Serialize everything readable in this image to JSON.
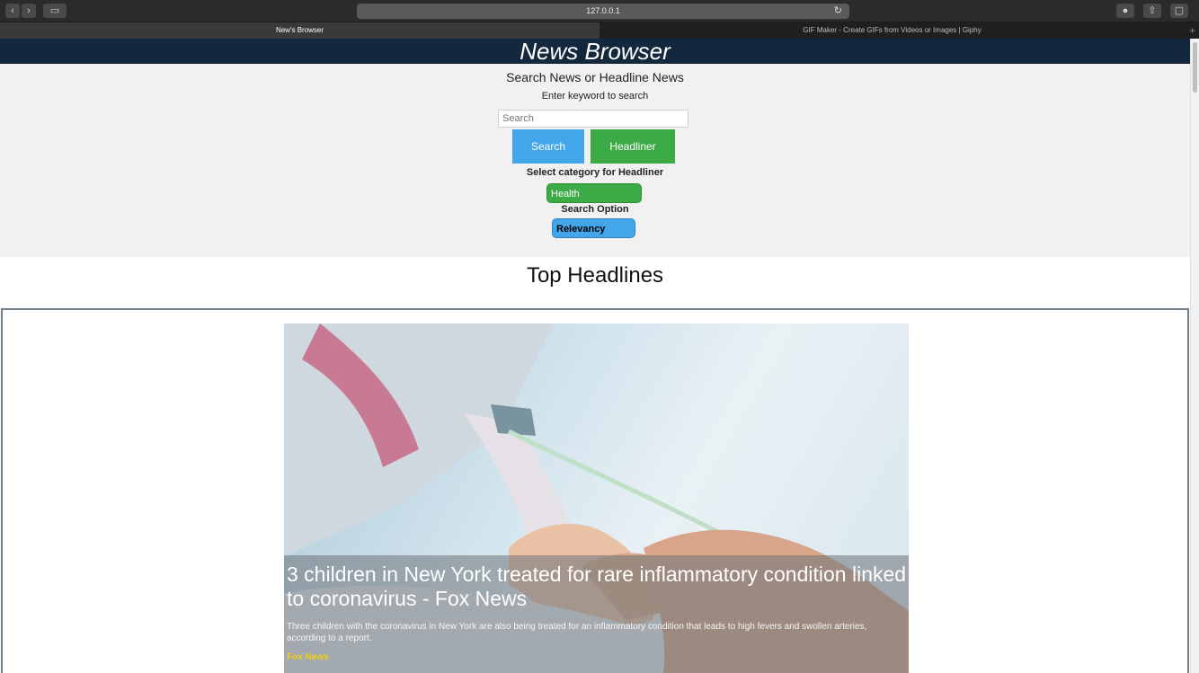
{
  "browser": {
    "url": "127.0.0.1",
    "tabs": [
      {
        "title": "New's Browser",
        "active": true
      },
      {
        "title": "GIF Maker - Create GIFs from Videos or Images | Giphy",
        "active": false
      }
    ]
  },
  "page": {
    "brand": "News Browser",
    "controls": {
      "section_title": "Search News or Headline News",
      "keyword_prompt": "Enter keyword to search",
      "search_placeholder": "Search",
      "search_button": "Search",
      "headliner_button": "Headliner",
      "category_label": "Select category for Headliner",
      "category_selected": "Health",
      "search_option_label": "Search Option",
      "search_option_selected": "Relevancy"
    },
    "top_headlines_title": "Top Headlines",
    "article": {
      "title": "3 children in New York treated for rare inflammatory condition linked to coronavirus - Fox News",
      "description": "Three children with the coronavirus in New York are also being treated for an inflammatory condition that leads to high fevers and swollen arteries, according to a report.",
      "source": "Fox News"
    }
  },
  "icons": [
    "chevron-left-icon",
    "chevron-right-icon",
    "sidebar-icon",
    "reload-icon",
    "download-icon",
    "share-icon",
    "tabs-overview-icon",
    "plus-icon"
  ],
  "colors": {
    "banner": "#14283d",
    "search_button": "#43a6ea",
    "headliner_button": "#3cab46",
    "source_text": "#f0cf14"
  }
}
